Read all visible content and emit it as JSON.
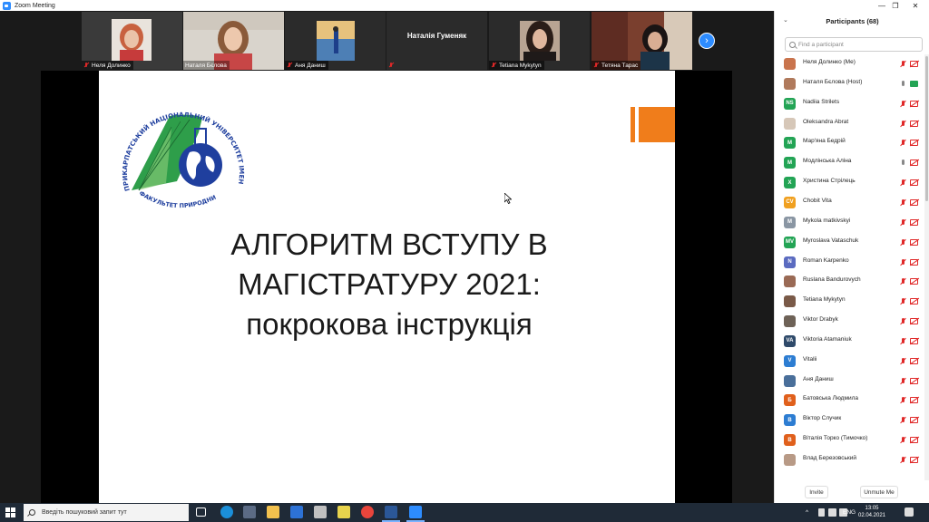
{
  "window": {
    "title": "Zoom Meeting",
    "min": "—",
    "max": "❐",
    "close": "✕"
  },
  "gallery": {
    "tiles": [
      {
        "name": "Неля Долинко"
      },
      {
        "name": "Наталя Бєлова"
      },
      {
        "name": "Аня Даниш"
      },
      {
        "name": "Наталія Гуменяк",
        "center_name": "Наталія Гуменяк"
      },
      {
        "name": "Tetiana Mykytyn"
      },
      {
        "name": "Тетяна Тарас"
      }
    ],
    "next_glyph": "›"
  },
  "slide": {
    "heading_lines": [
      "АЛГОРИТМ ВСТУПУ В",
      "МАГІСТРАТУРУ  2021:",
      "покрокова інструкція"
    ],
    "logo_text_outer": "ПРИКАРПАТСЬКИЙ НАЦІОНАЛЬНИЙ УНІВЕРСИТЕТ ІМЕНІ ВАСИЛЯ СТЕФАНИКА",
    "logo_text_inner": "ФАКУЛЬТЕТ ПРИРОДНИЧИХ НАУК",
    "colors": {
      "accent": "#f07d1b",
      "logo_green": "#2e9e4a",
      "logo_blue": "#1f3f9e"
    }
  },
  "participants": {
    "title": "Participants (68)",
    "collapse_glyph": "⌄",
    "search_placeholder": "Find a participant",
    "items": [
      {
        "initials": "",
        "name": "Неля Долинко (Me)",
        "color": "#c9744d",
        "photo": true,
        "mic": "off",
        "cam": "off"
      },
      {
        "initials": "",
        "name": "Наталя Бєлова (Host)",
        "color": "#b07a5c",
        "photo": true,
        "mic": "on",
        "cam": "on"
      },
      {
        "initials": "NS",
        "name": "Nadiia Strilets",
        "color": "#23a455",
        "photo": false,
        "mic": "off",
        "cam": "off"
      },
      {
        "initials": "",
        "name": "Oleksandra Abrat",
        "color": "#d6c7b8",
        "photo": true,
        "mic": "off",
        "cam": "off"
      },
      {
        "initials": "M",
        "name": "Мар'яна Бедрій",
        "color": "#23a455",
        "photo": false,
        "mic": "off",
        "cam": "off"
      },
      {
        "initials": "M",
        "name": "Модлінська Аліна",
        "color": "#23a455",
        "photo": false,
        "mic": "on",
        "cam": "off"
      },
      {
        "initials": "X",
        "name": "Христина Стрілець",
        "color": "#23a455",
        "photo": false,
        "mic": "off",
        "cam": "off"
      },
      {
        "initials": "CV",
        "name": "Chobit Vita",
        "color": "#f0a020",
        "photo": false,
        "mic": "off",
        "cam": "off"
      },
      {
        "initials": "M",
        "name": "Mykola matkivskyi",
        "color": "#8a96a3",
        "photo": false,
        "mic": "off",
        "cam": "off"
      },
      {
        "initials": "MV",
        "name": "Myroslava Vataschuk",
        "color": "#23a455",
        "photo": false,
        "mic": "off",
        "cam": "off"
      },
      {
        "initials": "N",
        "name": "Roman Karpenko",
        "color": "#5b6bc0",
        "photo": false,
        "mic": "off",
        "cam": "off"
      },
      {
        "initials": "",
        "name": "Ruslana Bandurovych",
        "color": "#9a6a55",
        "photo": true,
        "mic": "off",
        "cam": "off"
      },
      {
        "initials": "",
        "name": "Tetiana Mykytyn",
        "color": "#7a5a48",
        "photo": true,
        "mic": "off",
        "cam": "off"
      },
      {
        "initials": "",
        "name": "Viktor Drabyk",
        "color": "#6e6257",
        "photo": true,
        "mic": "off",
        "cam": "off"
      },
      {
        "initials": "VA",
        "name": "Viktoria Atamaniuk",
        "color": "#2f4a6a",
        "photo": false,
        "mic": "off",
        "cam": "off"
      },
      {
        "initials": "V",
        "name": "Vitalii",
        "color": "#2d7dd2",
        "photo": false,
        "mic": "off",
        "cam": "off"
      },
      {
        "initials": "",
        "name": "Аня Даниш",
        "color": "#4a6f9a",
        "photo": true,
        "mic": "off",
        "cam": "off"
      },
      {
        "initials": "Б",
        "name": "Батовська Людмила",
        "color": "#e0601c",
        "photo": false,
        "mic": "off",
        "cam": "off"
      },
      {
        "initials": "B",
        "name": "Віктор Случик",
        "color": "#2d7dd2",
        "photo": false,
        "mic": "off",
        "cam": "off"
      },
      {
        "initials": "B",
        "name": "Віталія Торко (Тимочко)",
        "color": "#e0601c",
        "photo": false,
        "mic": "off",
        "cam": "off"
      },
      {
        "initials": "",
        "name": "Влад Березовський",
        "color": "#b89a86",
        "photo": true,
        "mic": "off",
        "cam": "off"
      }
    ],
    "invite_label": "Invite",
    "unmute_label": "Unmute Me"
  },
  "taskbar": {
    "search_placeholder": "Введіть пошуковий запит тут",
    "language": "ENG",
    "time": "13:05",
    "date": "02.04.2021",
    "tray_up_glyph": "^"
  }
}
